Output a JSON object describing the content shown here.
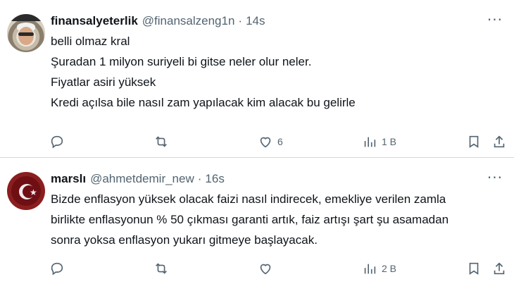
{
  "tweets": [
    {
      "name": "finansalyeterlik",
      "handle": "@finansalzeng1n",
      "dot": "·",
      "time": "14s",
      "more": "···",
      "lines": [
        "belli olmaz kral",
        "Şuradan 1 milyon suriyeli bi gitse neler olur neler.",
        "Fiyatlar asiri yüksek",
        "Kredi açılsa bile nasıl zam yapılacak kim alacak bu gelirle"
      ],
      "actions": {
        "reply": "",
        "retweet": "",
        "like": "6",
        "views": "1 B"
      }
    },
    {
      "name": "marslı",
      "handle": "@ahmetdemir_new",
      "dot": "·",
      "time": "16s",
      "more": "···",
      "lines": [
        "Bizde enflasyon yüksek olacak faizi nasıl indirecek, emekliye verilen zamla",
        "birlikte enflasyonun % 50 çıkması garanti artık, faiz artışı şart şu asamadan",
        "sonra yoksa enflasyon yukarı gitmeye başlayacak."
      ],
      "actions": {
        "reply": "",
        "retweet": "",
        "like": "",
        "views": "2 B"
      }
    }
  ],
  "icons": {
    "reply": "reply-icon",
    "retweet": "retweet-icon",
    "like": "heart-icon",
    "views": "analytics-icon",
    "bookmark": "bookmark-icon",
    "share": "share-icon",
    "more": "more-icon"
  },
  "colors": {
    "text": "#0f1419",
    "secondary": "#536471",
    "divider": "#cfd9de"
  }
}
